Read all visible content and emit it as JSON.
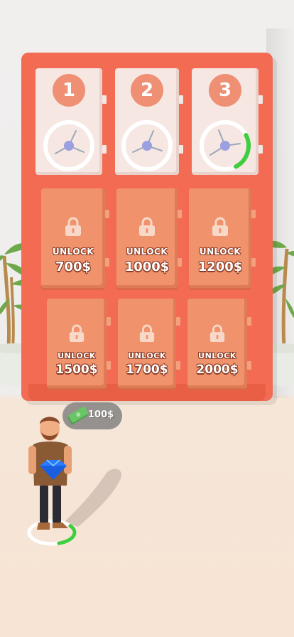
{
  "colors": {
    "cabinet": "#f26b52",
    "door_open": "#f6e7e3",
    "door_locked": "#f0936c",
    "badge": "#ef8f73",
    "progress_green": "#3fce3f"
  },
  "vaults_open": [
    {
      "number": "1",
      "dial_progress": 0
    },
    {
      "number": "2",
      "dial_progress": 0
    },
    {
      "number": "3",
      "dial_progress": 0.25
    }
  ],
  "vaults_locked": [
    {
      "label": "UNLOCK",
      "price": "700$"
    },
    {
      "label": "UNLOCK",
      "price": "1000$"
    },
    {
      "label": "UNLOCK",
      "price": "1200$"
    },
    {
      "label": "UNLOCK",
      "price": "1500$"
    },
    {
      "label": "UNLOCK",
      "price": "1700$"
    },
    {
      "label": "UNLOCK",
      "price": "2000$"
    }
  ],
  "player": {
    "money": "100$",
    "money_icon": "cash-icon",
    "held_item": "diamond-icon",
    "progress": 0.3
  }
}
